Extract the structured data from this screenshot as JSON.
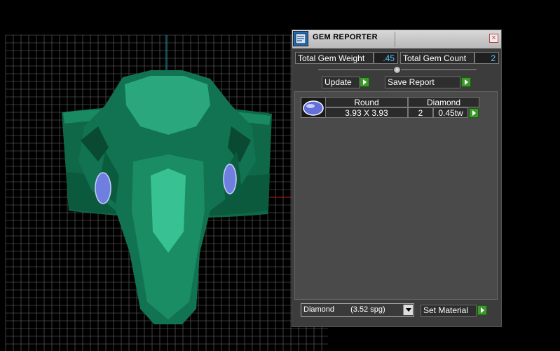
{
  "viewport": {
    "model": "emerald-green dragon head ring with two set diamonds",
    "colors": {
      "background": "#000000",
      "grid": "#6a6a6a",
      "model": "#137a55",
      "gem": "#6f7fe0",
      "axis_vertical": "#16a3b8",
      "axis_horizontal": "#c41a1a"
    }
  },
  "panel": {
    "title": "GEM REPORTER",
    "close_icon": "close-icon",
    "total_gem_weight_label": "Total Gem Weight",
    "total_gem_weight_value": ".45",
    "total_gem_count_label": "Total Gem Count",
    "total_gem_count_value": "2",
    "update_label": "Update",
    "save_report_label": "Save Report",
    "gems": [
      {
        "shape": "Round",
        "material": "Diamond",
        "size": "3.93 X 3.93",
        "count": "2",
        "weight": "0.45tw"
      }
    ],
    "material_select": {
      "name": "Diamond",
      "spg": "(3.52 spg)"
    },
    "set_material_label": "Set Material",
    "colors": {
      "value_text": "#4fc3f7",
      "arrow_button": "#3c9a2a"
    }
  }
}
